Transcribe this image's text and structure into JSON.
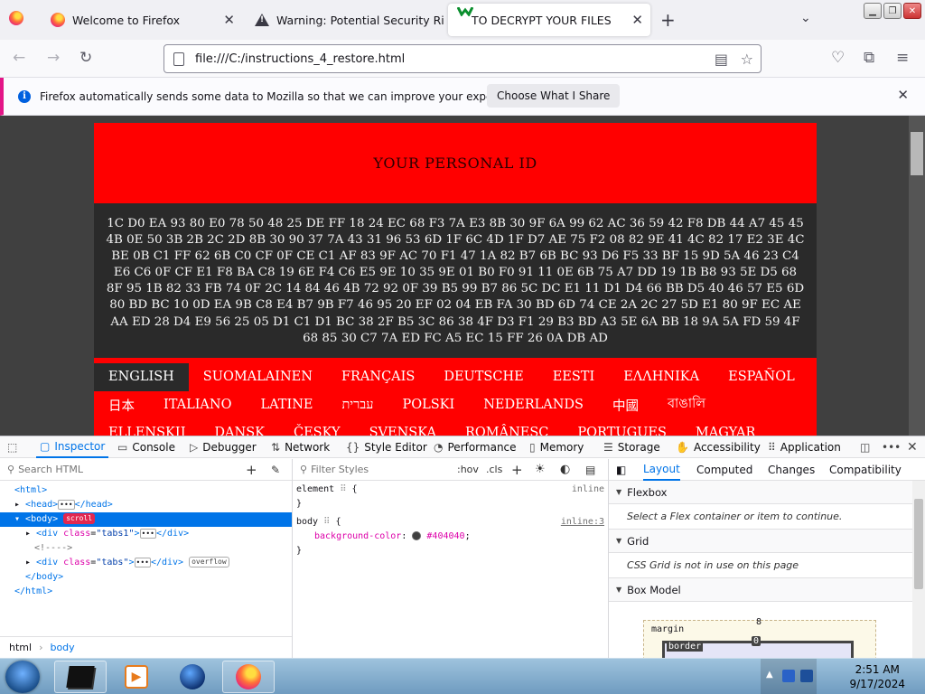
{
  "browser": {
    "tabs": [
      {
        "label": "Welcome to Firefox",
        "icon": "firefox-icon",
        "active": false
      },
      {
        "label": "Warning: Potential Security Ri",
        "icon": "warning-icon",
        "active": false
      },
      {
        "label": "TO DECRYPT YOUR FILES",
        "icon": "",
        "active": true
      }
    ],
    "new_tab": "+",
    "url": "file:///C:/instructions_4_restore.html"
  },
  "notification": {
    "text": "Firefox automatically sends some data to Mozilla so that we can improve your experience.",
    "button": "Choose What I Share"
  },
  "page": {
    "id_title": "YOUR PERSONAL ID",
    "id_value": "1C D0 EA 93 80 E0 78 50 48 25 DE FF 18 24 EC 68 F3 7A E3 8B 30 9F 6A 99 62 AC 36 59 42 F8 DB 44 A7 45 45 4B 0E 50 3B 2B 2C 2D 8B 30 90 37 7A 43 31 96 53 6D 1F 6C 4D 1F D7 AE 75 F2 08 82 9E 41 4C 82 17 E2 3E 4C BE 0B C1 FF 62 6B C0 CF 0F CE C1 AF 83 9F AC 70 F1 47 1A 82 B7 6B BC 93 D6 F5 33 BF 15 9D 5A 46 23 C4 E6 C6 0F CF E1 F8 BA C8 19 6E F4 C6 E5 9E 10 35 9E 01 B0 F0 91 11 0E 6B 75 A7 DD 19 1B B8 93 5E D5 68 8F 95 1B 82 33 FB 74 0F 2C 14 84 46 4B 72 92 0F 39 B5 99 B7 86 5C DC E1 11 D1 D4 66 BB D5 40 46 57 E5 6D 80 BD BC 10 0D EA 9B C8 E4 B7 9B F7 46 95 20 EF 02 04 EB FA 30 BD 6D 74 CE 2A 2C 27 5D E1 80 9F EC AE AA ED 28 D4 E9 56 25 05 D1 C1 D1 BC 38 2F B5 3C 86 38 4F D3 F1 29 B3 BD A3 5E 6A BB 18 9A 5A FD 59 4F 68 85 30 C7 7A ED FC A5 EC 15 FF 26 0A DB AD",
    "languages_row1": [
      "ENGLISH",
      "SUOMALAINEN",
      "FRANÇAIS",
      "DEUTSCHE",
      "EESTI",
      "ΕΛΛΗΝΙΚΑ",
      "ESPAÑOL"
    ],
    "languages_row2": [
      "日本",
      "ITALIANO",
      "LATINE",
      "עברית",
      "POLSKI",
      "NEDERLANDS",
      "中國",
      "বাঙালি"
    ],
    "languages_row3": [
      "ELLENSKIJ",
      "DANSK",
      "ČESKY",
      "SVENSKA",
      "ROMÂNESC",
      "PORTUGUES",
      "MAGYAR"
    ]
  },
  "devtools": {
    "tabs": [
      "Inspector",
      "Console",
      "Debugger",
      "Network",
      "Style Editor",
      "Performance",
      "Memory",
      "Storage",
      "Accessibility",
      "Application"
    ],
    "search_placeholder": "Search HTML",
    "filter_placeholder": "Filter Styles",
    "hov": ":hov",
    "cls": ".cls",
    "tree": {
      "html_open": "<html>",
      "head": "<head>",
      "head_close": "</head>",
      "body_open": "<body>",
      "scroll_badge": "scroll",
      "div1_class": "tabs1",
      "comment": "<!---->",
      "div2_class": "tabs",
      "overflow_badge": "overflow",
      "body_close": "</body>",
      "html_close": "</html>"
    },
    "breadcrumbs": [
      "html",
      "body"
    ],
    "rules": {
      "element_selector": "element",
      "element_source": "inline",
      "body_selector": "body",
      "body_source": "inline:3",
      "prop_name": "background-color",
      "prop_value": "#404040"
    },
    "layout_tabs": [
      "Layout",
      "Computed",
      "Changes",
      "Compatibility"
    ],
    "sections": [
      {
        "title": "Flexbox",
        "body": "Select a Flex container or item to continue."
      },
      {
        "title": "Grid",
        "body": "CSS Grid is not in use on this page"
      },
      {
        "title": "Box Model",
        "body": ""
      }
    ],
    "box_model": {
      "margin_label": "margin",
      "margin_value": "8",
      "border_label": "border",
      "border_value": "0"
    }
  },
  "taskbar": {
    "time": "2:51 AM",
    "date": "9/17/2024"
  }
}
